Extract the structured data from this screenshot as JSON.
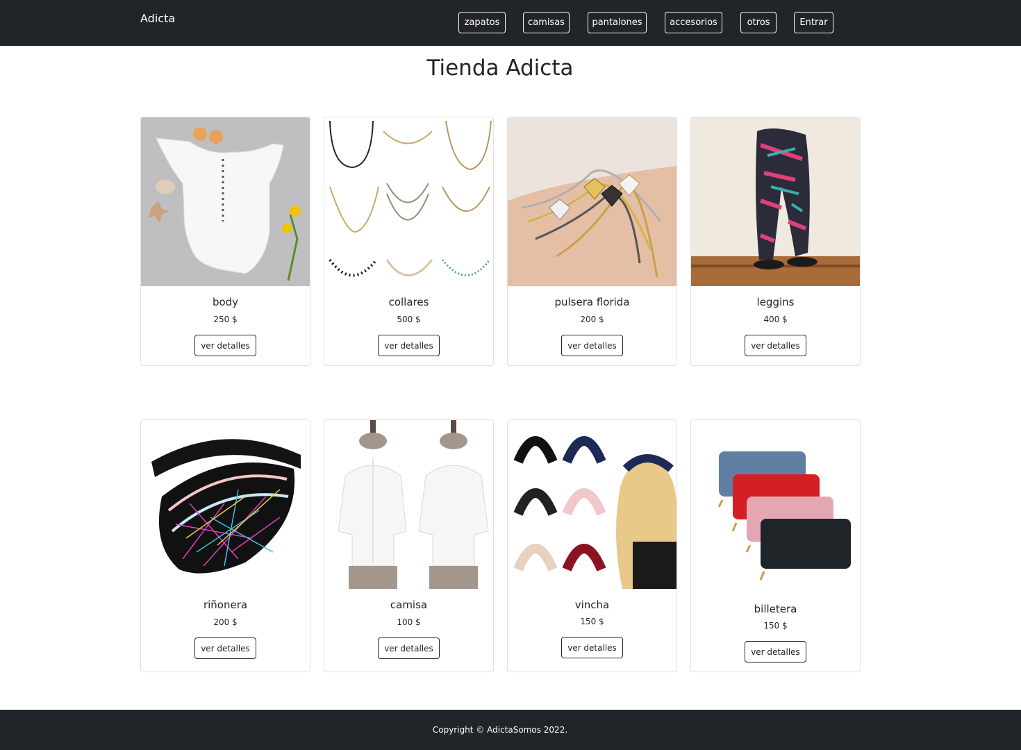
{
  "navbar": {
    "brand": "Adicta",
    "items": [
      {
        "label": "zapatos"
      },
      {
        "label": "camisas"
      },
      {
        "label": "pantalones"
      },
      {
        "label": "accesorios"
      },
      {
        "label": "otros"
      },
      {
        "label": "Entrar"
      }
    ]
  },
  "page": {
    "title": "Tienda Adicta"
  },
  "products": [
    {
      "name": "body",
      "price": "250 $",
      "button": "ver detalles"
    },
    {
      "name": "collares",
      "price": "500 $",
      "button": "ver detalles"
    },
    {
      "name": "pulsera florida",
      "price": "200 $",
      "button": "ver detalles"
    },
    {
      "name": "leggins",
      "price": "400 $",
      "button": "ver detalles"
    },
    {
      "name": "riñonera",
      "price": "200 $",
      "button": "ver detalles"
    },
    {
      "name": "camisa",
      "price": "100 $",
      "button": "ver detalles"
    },
    {
      "name": "vincha",
      "price": "150 $",
      "button": "ver detalles"
    },
    {
      "name": "billetera",
      "price": "150 $",
      "button": "ver detalles"
    }
  ],
  "footer": {
    "copyright": "Copyright © AdictaSomos 2022."
  },
  "colors": {
    "dark": "#212529",
    "light": "#ffffff",
    "border": "#dee2e6"
  }
}
